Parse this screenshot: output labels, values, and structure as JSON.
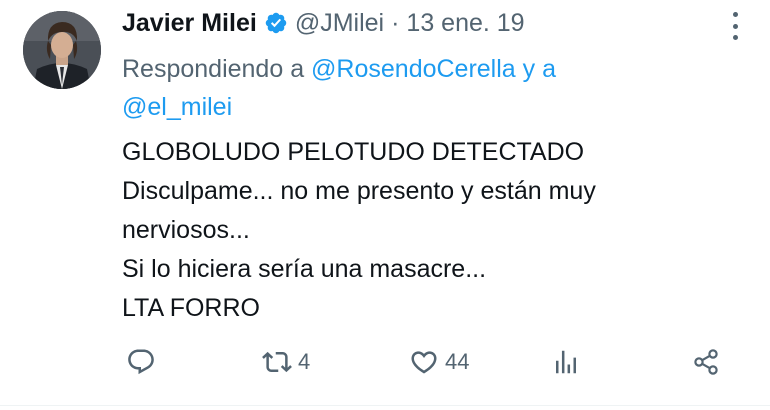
{
  "tweet": {
    "author": {
      "name": "Javier Milei",
      "handle": "@JMilei",
      "verified": true,
      "avatar_icon": "profile-photo"
    },
    "separator": "·",
    "date": "13 ene. 19",
    "replying": {
      "prefix": "Respondiendo a ",
      "mention_1": "@RosendoCerella",
      "conjunction": " y a",
      "mention_2": "@el_milei"
    },
    "body_lines": [
      "GLOBOLUDO PELOTUDO DETECTADO",
      "Disculpame... no me presento y están muy",
      "nerviosos...",
      "Si lo hiciera sería una masacre...",
      "LTA FORRO"
    ],
    "actions": {
      "reply_icon": "reply-icon",
      "retweet_icon": "retweet-icon",
      "retweet_count": "4",
      "like_icon": "heart-icon",
      "like_count": "44",
      "views_icon": "views-icon",
      "share_icon": "share-icon"
    }
  },
  "colors": {
    "text_primary": "#0f1419",
    "text_secondary": "#536471",
    "link": "#1d9bf0",
    "verified": "#1d9bf0"
  }
}
